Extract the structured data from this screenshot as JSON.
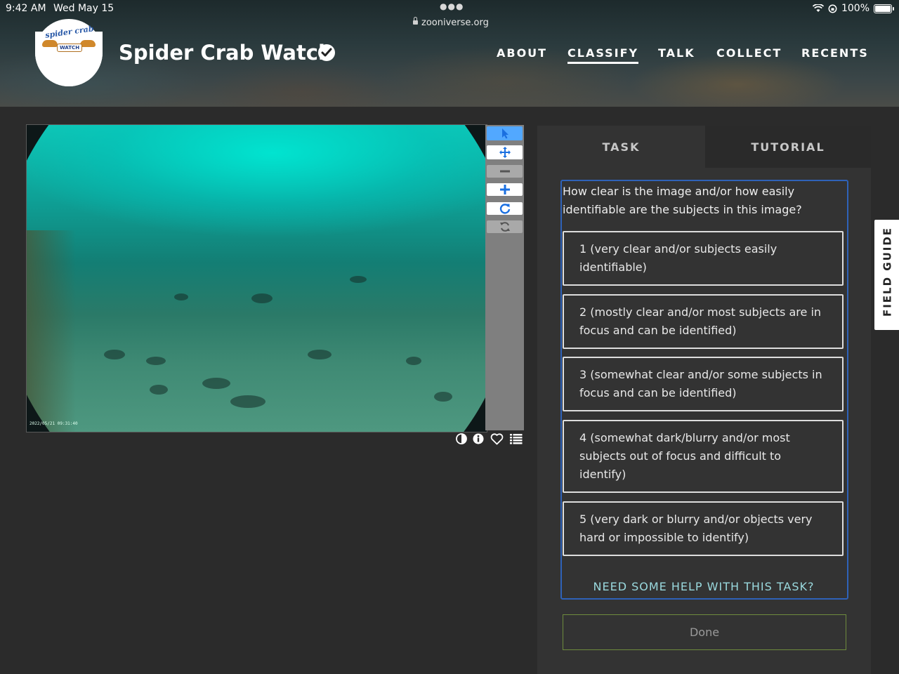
{
  "status_bar": {
    "time": "9:42 AM",
    "date": "Wed May 15",
    "url": "zooniverse.org",
    "battery": "100%",
    "battery_level": 1.0
  },
  "project": {
    "title": "Spider Crab Watch",
    "logo_text_top": "spider crab",
    "logo_badge": "WATCH"
  },
  "nav": {
    "items": [
      "ABOUT",
      "CLASSIFY",
      "TALK",
      "COLLECT",
      "RECENTS"
    ],
    "active": "CLASSIFY"
  },
  "viewer": {
    "timestamp": "2022/05/21 09:31:40",
    "tools": [
      "pointer-icon",
      "move-icon",
      "zoom-out-icon",
      "zoom-in-icon",
      "rotate-icon",
      "reset-icon"
    ],
    "under_icons": [
      "invert-icon",
      "info-icon",
      "favorite-icon",
      "collections-icon"
    ]
  },
  "panel": {
    "tabs": [
      "TASK",
      "TUTORIAL"
    ],
    "question": "How clear is the image and/or how easily identifiable are the subjects in this image?",
    "answers": [
      "1 (very clear and/or subjects easily identifiable)",
      "2 (mostly clear and/or most subjects are in focus and can be identified)",
      "3 (somewhat clear and/or some subjects in focus and can be identified)",
      "4 (somewhat dark/blurry and/or most subjects out of focus and difficult to identify)",
      "5 (very dark or blurry and/or objects very hard or impossible to identify)"
    ],
    "help": "NEED SOME HELP WITH THIS TASK?",
    "done": "Done"
  },
  "field_guide": "FIELD GUIDE",
  "colors": {
    "page_bg": "#2b2b2b",
    "panel_bg": "#333333",
    "task_border": "#2f62b8",
    "help_text": "#9ad9de",
    "tool_selected": "#52a8ff",
    "done_border": "#6e8b3d"
  }
}
